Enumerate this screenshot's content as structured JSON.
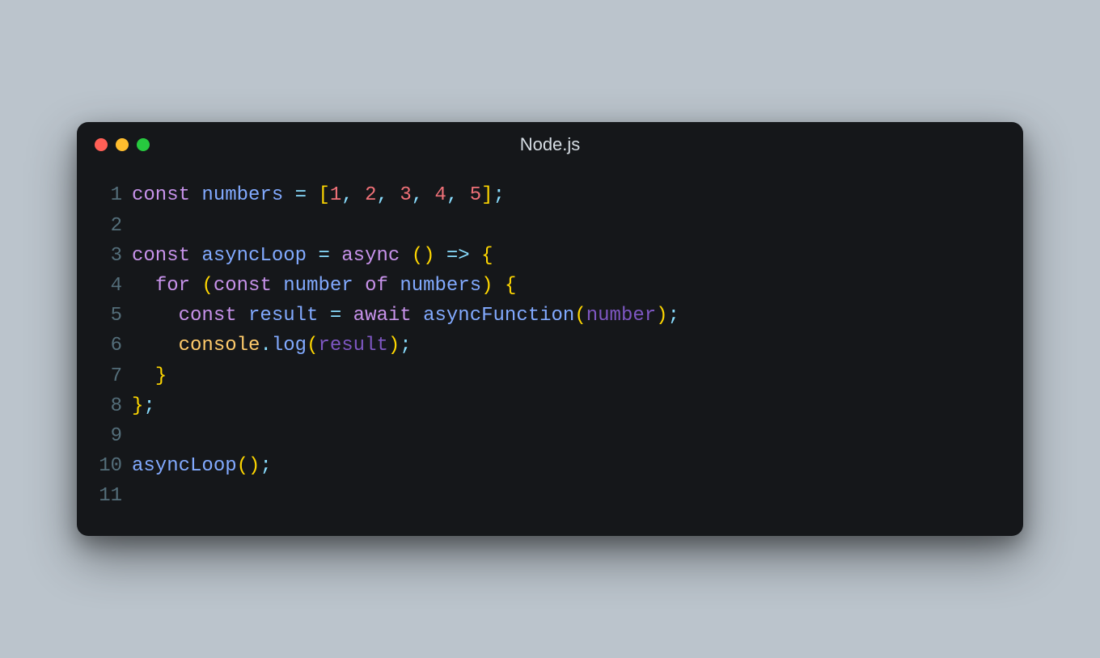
{
  "window": {
    "title": "Node.js",
    "trafficLights": {
      "red": "#ff5f56",
      "yellow": "#ffbd2e",
      "green": "#27c93f"
    }
  },
  "code": {
    "language": "javascript",
    "lines": [
      {
        "num": "1",
        "tokens": [
          {
            "t": "const",
            "c": "keyword"
          },
          {
            "t": " ",
            "c": "plain"
          },
          {
            "t": "numbers",
            "c": "var"
          },
          {
            "t": " ",
            "c": "plain"
          },
          {
            "t": "=",
            "c": "operator"
          },
          {
            "t": " ",
            "c": "plain"
          },
          {
            "t": "[",
            "c": "bracket"
          },
          {
            "t": "1",
            "c": "number"
          },
          {
            "t": ",",
            "c": "punct"
          },
          {
            "t": " ",
            "c": "plain"
          },
          {
            "t": "2",
            "c": "number"
          },
          {
            "t": ",",
            "c": "punct"
          },
          {
            "t": " ",
            "c": "plain"
          },
          {
            "t": "3",
            "c": "number"
          },
          {
            "t": ",",
            "c": "punct"
          },
          {
            "t": " ",
            "c": "plain"
          },
          {
            "t": "4",
            "c": "number"
          },
          {
            "t": ",",
            "c": "punct"
          },
          {
            "t": " ",
            "c": "plain"
          },
          {
            "t": "5",
            "c": "number"
          },
          {
            "t": "]",
            "c": "bracket"
          },
          {
            "t": ";",
            "c": "punct"
          }
        ]
      },
      {
        "num": "2",
        "tokens": []
      },
      {
        "num": "3",
        "tokens": [
          {
            "t": "const",
            "c": "keyword"
          },
          {
            "t": " ",
            "c": "plain"
          },
          {
            "t": "asyncLoop",
            "c": "func"
          },
          {
            "t": " ",
            "c": "plain"
          },
          {
            "t": "=",
            "c": "operator"
          },
          {
            "t": " ",
            "c": "plain"
          },
          {
            "t": "async",
            "c": "keyword"
          },
          {
            "t": " ",
            "c": "plain"
          },
          {
            "t": "(",
            "c": "bracket"
          },
          {
            "t": ")",
            "c": "bracket"
          },
          {
            "t": " ",
            "c": "plain"
          },
          {
            "t": "=>",
            "c": "operator"
          },
          {
            "t": " ",
            "c": "plain"
          },
          {
            "t": "{",
            "c": "bracket"
          }
        ]
      },
      {
        "num": "4",
        "tokens": [
          {
            "t": "  ",
            "c": "plain"
          },
          {
            "t": "for",
            "c": "keyword"
          },
          {
            "t": " ",
            "c": "plain"
          },
          {
            "t": "(",
            "c": "bracket"
          },
          {
            "t": "const",
            "c": "keyword"
          },
          {
            "t": " ",
            "c": "plain"
          },
          {
            "t": "number",
            "c": "var"
          },
          {
            "t": " ",
            "c": "plain"
          },
          {
            "t": "of",
            "c": "keyword"
          },
          {
            "t": " ",
            "c": "plain"
          },
          {
            "t": "numbers",
            "c": "var"
          },
          {
            "t": ")",
            "c": "bracket"
          },
          {
            "t": " ",
            "c": "plain"
          },
          {
            "t": "{",
            "c": "bracket"
          }
        ]
      },
      {
        "num": "5",
        "tokens": [
          {
            "t": "    ",
            "c": "plain"
          },
          {
            "t": "const",
            "c": "keyword"
          },
          {
            "t": " ",
            "c": "plain"
          },
          {
            "t": "result",
            "c": "var"
          },
          {
            "t": " ",
            "c": "plain"
          },
          {
            "t": "=",
            "c": "operator"
          },
          {
            "t": " ",
            "c": "plain"
          },
          {
            "t": "await",
            "c": "keyword"
          },
          {
            "t": " ",
            "c": "plain"
          },
          {
            "t": "asyncFunction",
            "c": "func"
          },
          {
            "t": "(",
            "c": "bracket"
          },
          {
            "t": "number",
            "c": "param"
          },
          {
            "t": ")",
            "c": "bracket"
          },
          {
            "t": ";",
            "c": "punct"
          }
        ]
      },
      {
        "num": "6",
        "tokens": [
          {
            "t": "    ",
            "c": "plain"
          },
          {
            "t": "console",
            "c": "builtin"
          },
          {
            "t": ".",
            "c": "punct"
          },
          {
            "t": "log",
            "c": "property"
          },
          {
            "t": "(",
            "c": "bracket"
          },
          {
            "t": "result",
            "c": "param"
          },
          {
            "t": ")",
            "c": "bracket"
          },
          {
            "t": ";",
            "c": "punct"
          }
        ]
      },
      {
        "num": "7",
        "tokens": [
          {
            "t": "  ",
            "c": "plain"
          },
          {
            "t": "}",
            "c": "bracket"
          }
        ]
      },
      {
        "num": "8",
        "tokens": [
          {
            "t": "}",
            "c": "bracket"
          },
          {
            "t": ";",
            "c": "punct"
          }
        ]
      },
      {
        "num": "9",
        "tokens": []
      },
      {
        "num": "10",
        "tokens": [
          {
            "t": "asyncLoop",
            "c": "func"
          },
          {
            "t": "(",
            "c": "bracket"
          },
          {
            "t": ")",
            "c": "bracket"
          },
          {
            "t": ";",
            "c": "punct"
          }
        ]
      },
      {
        "num": "11",
        "tokens": []
      }
    ]
  }
}
